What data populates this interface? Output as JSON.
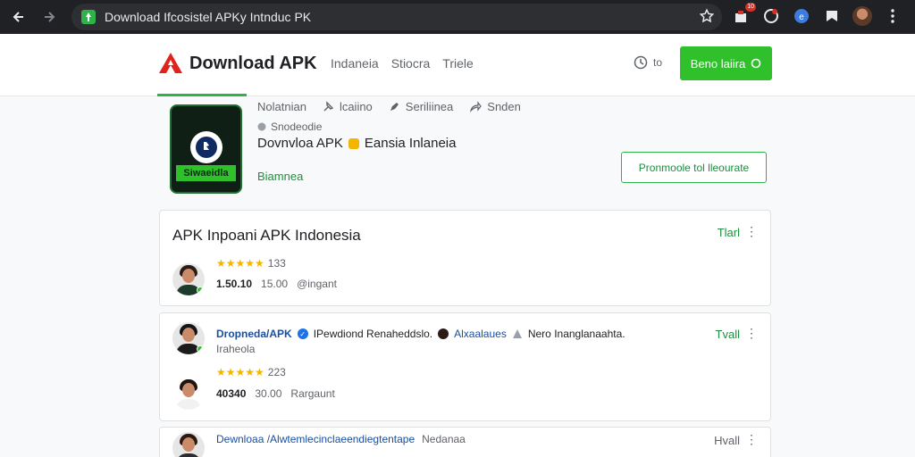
{
  "browser": {
    "url": "Download Ifcosistel APKy Intnduc PK",
    "badge_count": "10"
  },
  "header": {
    "brand": "Download APK",
    "nav": [
      "Indaneia",
      "Stiocra",
      "Triele"
    ],
    "util_label": "to",
    "cta_label": "Beno laiira"
  },
  "app": {
    "icon_label": "Siwaeidla",
    "breadcrumb": [
      "Nolatnian",
      "lcaiino",
      "Seriliinea",
      "Snden"
    ],
    "developer": "Snodeodie",
    "title_left": "Dovnvloa APK",
    "title_right": "Eansia Inlaneia",
    "link": "Biamnea",
    "outline_button": "Pronmoole tol lleourate"
  },
  "cards": [
    {
      "title": "APK Inpoani APK Indonesia",
      "action": "Tlarl",
      "rating_count": "133",
      "version": "1.50.10",
      "date": "15.00",
      "tag": "@ingant"
    },
    {
      "author": "Dropneda/APK",
      "post_text": "IPewdiond Renaheddslo.",
      "chip1": "Alxaalaues",
      "chip2": "Nero Inanglanaahta.",
      "sub": "Iraheola",
      "action": "Tvall",
      "rating_count": "223",
      "version": "40340",
      "date": "30.00",
      "tag": "Rargaunt"
    },
    {
      "author": "Dewnloaa /Alwtemlecinclaeendiegtentape",
      "tag": "Nedanaa",
      "action": "Hvall"
    }
  ],
  "colors": {
    "accent": "#30c02c",
    "link_blue": "#1a4fa0",
    "star": "#f2b600"
  }
}
